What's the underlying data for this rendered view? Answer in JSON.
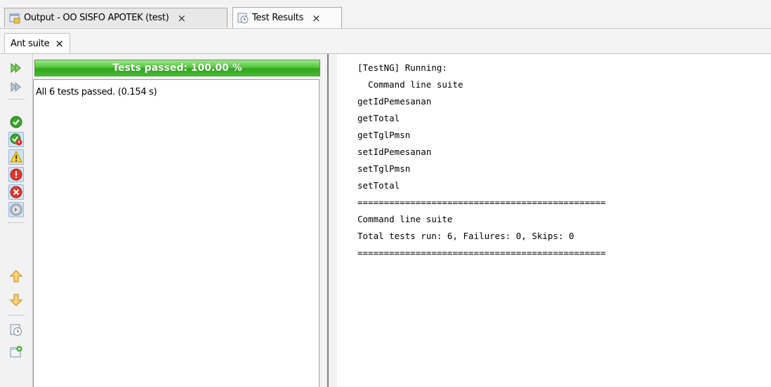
{
  "tabs": [
    {
      "label": "Output - OO SISFO APOTEK (test)",
      "close": "×",
      "icon": "output-icon"
    },
    {
      "label": "Test Results",
      "close": "×",
      "icon": "test-results-icon"
    }
  ],
  "subtab": {
    "label": "Ant suite",
    "close": "×"
  },
  "toolbar": {
    "icons": [
      "rerun-icon",
      "rerun-failed-icon",
      "show-passed-icon",
      "show-passed-with-errors-icon",
      "show-warnings-icon",
      "show-failed-icon",
      "show-errors-icon",
      "show-skipped-icon",
      "previous-failure-icon",
      "next-failure-icon",
      "test-history-icon",
      "new-test-icon"
    ]
  },
  "results": {
    "progress_label": "Tests passed: 100.00 %",
    "progress_percent": 100,
    "summary": "All 6 tests passed. (0.154 s)"
  },
  "output": {
    "lines": [
      "[TestNG] Running:",
      "  Command line suite",
      "getIdPemesanan",
      "getTotal",
      "getTglPmsn",
      "setIdPemesanan",
      "setTglPmsn",
      "setTotal",
      "===============================================",
      "Command line suite",
      "Total tests run: 6, Failures: 0, Skips: 0",
      "==============================================="
    ]
  },
  "colors": {
    "progress_green": "#3fb52a",
    "selected_tool": "#cfe3f5"
  }
}
